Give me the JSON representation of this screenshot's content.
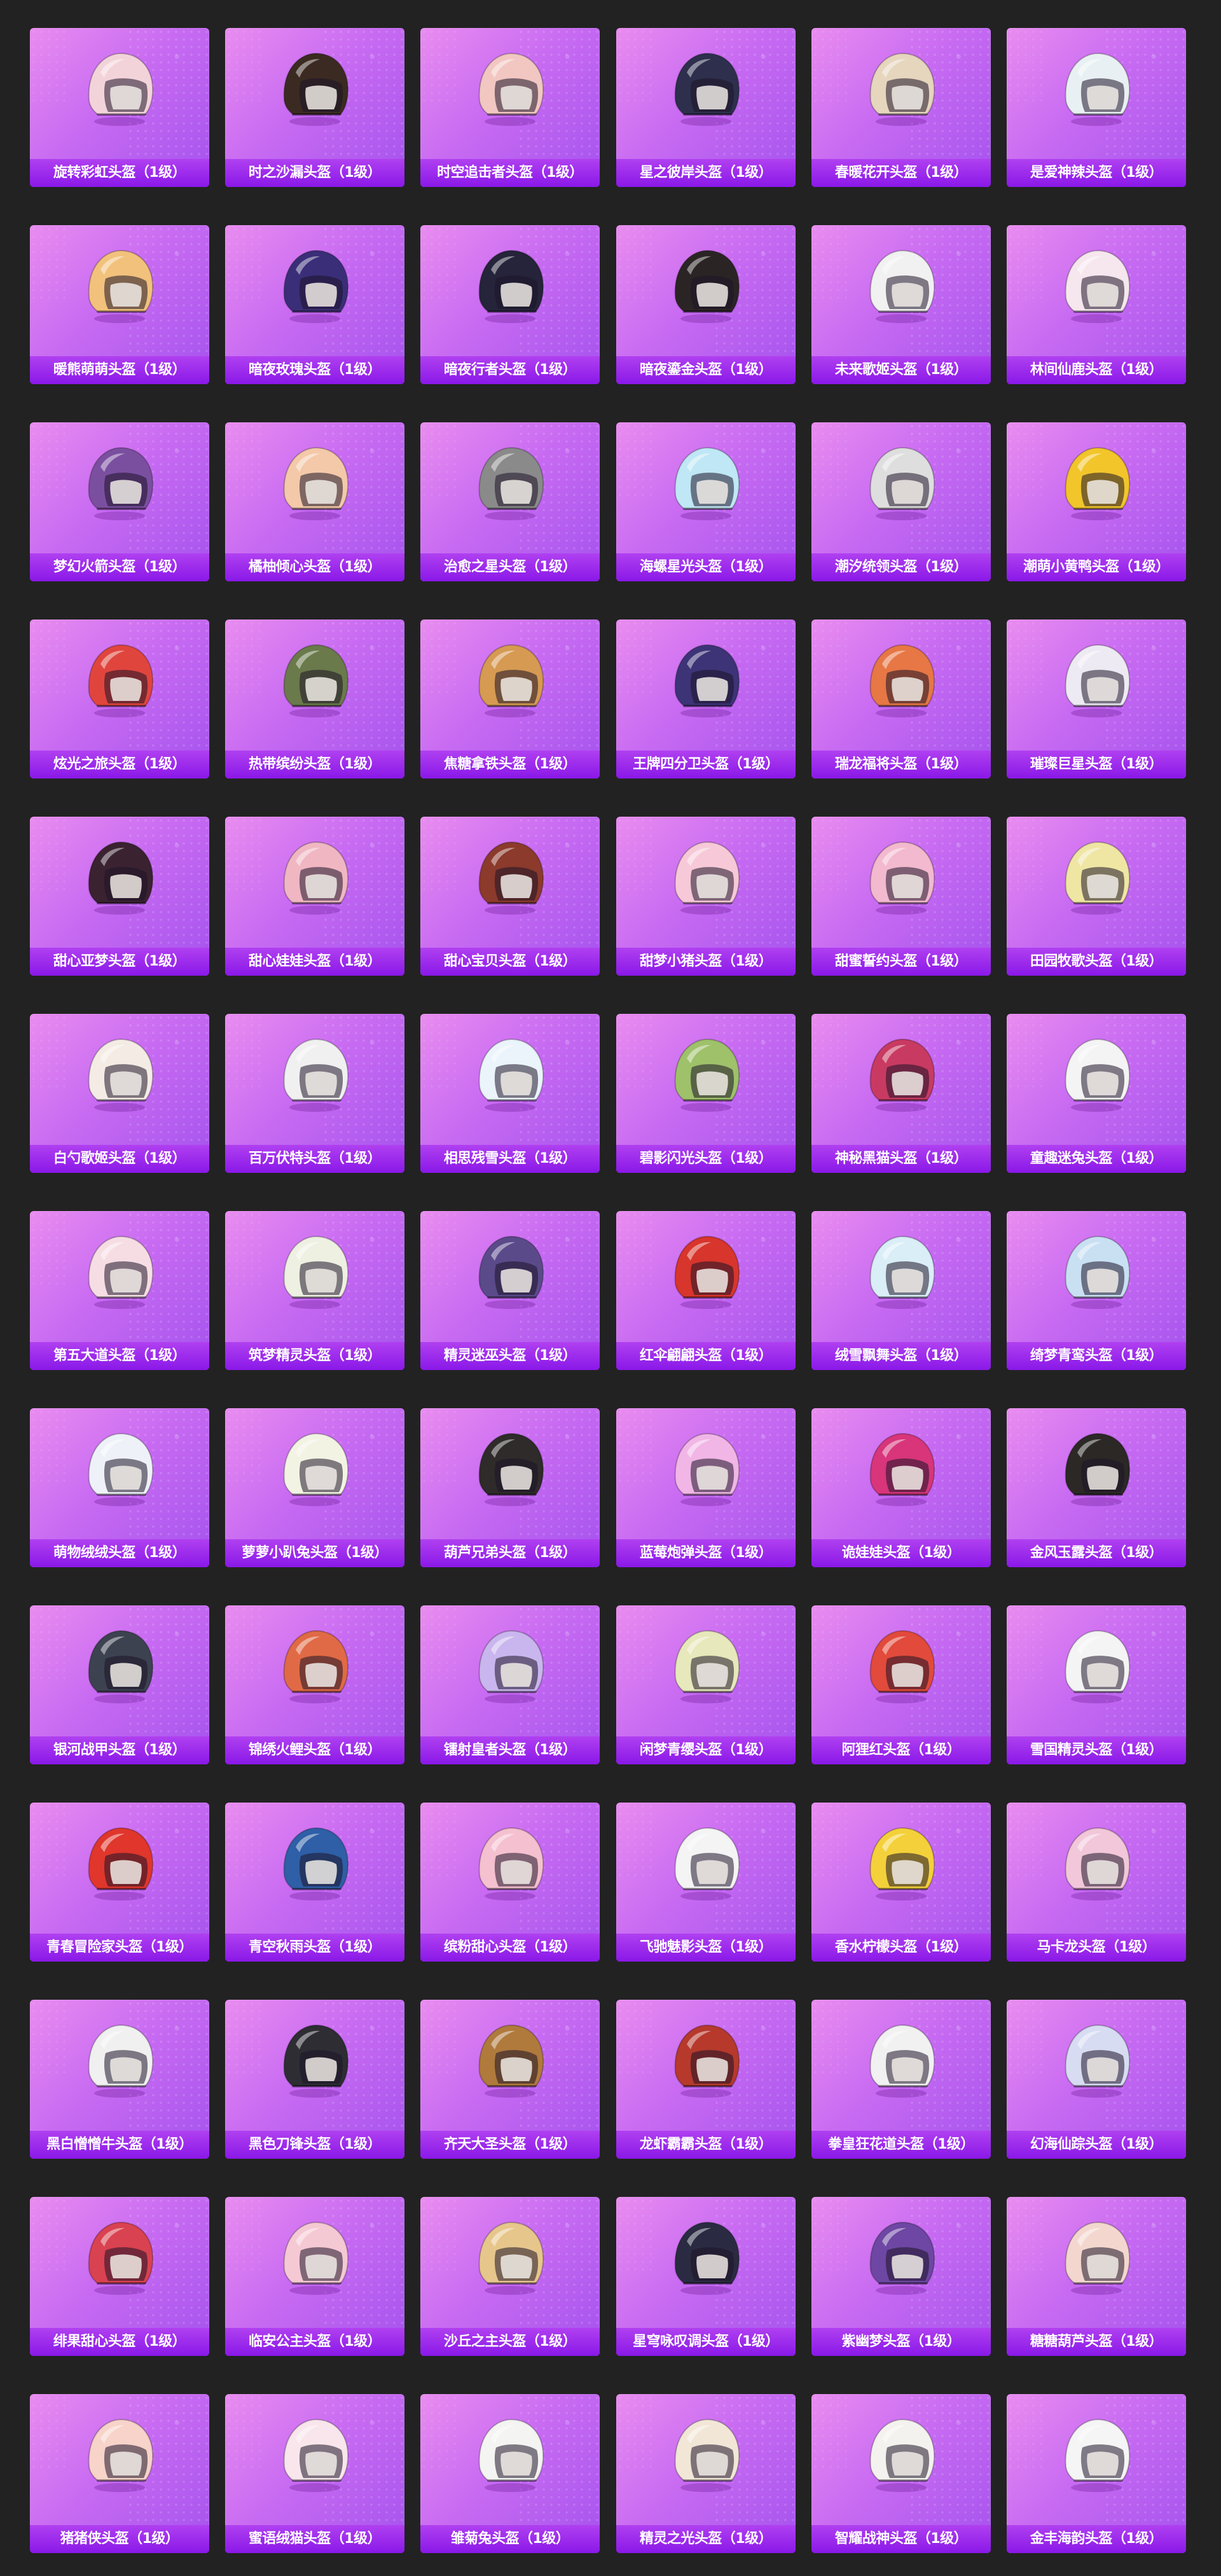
{
  "items": [
    {
      "name": "旋转彩虹头盔（1级）",
      "color": "#f3d3da"
    },
    {
      "name": "时之沙漏头盔（1级）",
      "color": "#3b2a22"
    },
    {
      "name": "时空追击者头盔（1级）",
      "color": "#f2c7c2"
    },
    {
      "name": "星之彼岸头盔（1级）",
      "color": "#2d2f4d"
    },
    {
      "name": "春暖花开头盔（1级）",
      "color": "#e6d6bd"
    },
    {
      "name": "是爱神辣头盔（1级）",
      "color": "#e9f0f3"
    },
    {
      "name": "暖熊萌萌头盔（1级）",
      "color": "#f2c27c"
    },
    {
      "name": "暗夜玫瑰头盔（1级）",
      "color": "#3a2e78"
    },
    {
      "name": "暗夜行者头盔（1级）",
      "color": "#25243a"
    },
    {
      "name": "暗夜鎏金头盔（1级）",
      "color": "#2b2424"
    },
    {
      "name": "未来歌姬头盔（1级）",
      "color": "#f1f1f1"
    },
    {
      "name": "林间仙鹿头盔（1级）",
      "color": "#f6e7ee"
    },
    {
      "name": "梦幻火箭头盔（1级）",
      "color": "#7b4fa0"
    },
    {
      "name": "橘柚倾心头盔（1级）",
      "color": "#f4c9a9"
    },
    {
      "name": "治愈之星头盔（1级）",
      "color": "#8a8a8a"
    },
    {
      "name": "海螺星光头盔（1级）",
      "color": "#bfe7f5"
    },
    {
      "name": "潮汐统领头盔（1级）",
      "color": "#dedede"
    },
    {
      "name": "潮萌小黄鸭头盔（1级）",
      "color": "#f2c52b"
    },
    {
      "name": "炫光之旅头盔（1级）",
      "color": "#e0453d"
    },
    {
      "name": "热带缤纷头盔（1级）",
      "color": "#6a7a4b"
    },
    {
      "name": "焦糖拿铁头盔（1级）",
      "color": "#d69a52"
    },
    {
      "name": "王牌四分卫头盔（1级）",
      "color": "#3d3377"
    },
    {
      "name": "瑞龙福将头盔（1级）",
      "color": "#e77745"
    },
    {
      "name": "璀璨巨星头盔（1级）",
      "color": "#eeeaf4"
    },
    {
      "name": "甜心亚梦头盔（1级）",
      "color": "#3a2230"
    },
    {
      "name": "甜心娃娃头盔（1级）",
      "color": "#f0b7c3"
    },
    {
      "name": "甜心宝贝头盔（1级）",
      "color": "#8b3a2c"
    },
    {
      "name": "甜梦小猪头盔（1级）",
      "color": "#f7c9d8"
    },
    {
      "name": "甜蜜誓约头盔（1级）",
      "color": "#f3b9ce"
    },
    {
      "name": "田园牧歌头盔（1级）",
      "color": "#efe6a4"
    },
    {
      "name": "白勺歌姬头盔（1级）",
      "color": "#f4ece4"
    },
    {
      "name": "百万伏特头盔（1级）",
      "color": "#f0f0f0"
    },
    {
      "name": "相思残雪头盔（1级）",
      "color": "#eaf4fa"
    },
    {
      "name": "碧影闪光头盔（1级）",
      "color": "#9ec16a"
    },
    {
      "name": "神秘黑猫头盔（1级）",
      "color": "#c83a62"
    },
    {
      "name": "童趣迷兔头盔（1级）",
      "color": "#f4f4f4"
    },
    {
      "name": "第五大道头盔（1级）",
      "color": "#f6dde4"
    },
    {
      "name": "筑梦精灵头盔（1级）",
      "color": "#eef0e2"
    },
    {
      "name": "精灵迷巫头盔（1级）",
      "color": "#5b4a8a"
    },
    {
      "name": "红伞翩翩头盔（1级）",
      "color": "#d8352c"
    },
    {
      "name": "绒雪飘舞头盔（1级）",
      "color": "#d9eef7"
    },
    {
      "name": "绮梦青鸾头盔（1级）",
      "color": "#c9e0f3"
    },
    {
      "name": "萌物绒绒头盔（1级）",
      "color": "#eef2f8"
    },
    {
      "name": "萝萝小趴兔头盔（1级）",
      "color": "#f3f3e4"
    },
    {
      "name": "葫芦兄弟头盔（1级）",
      "color": "#2e2b2a"
    },
    {
      "name": "蓝莓炮弹头盔（1级）",
      "color": "#f1b6e6"
    },
    {
      "name": "诡娃娃头盔（1级）",
      "color": "#d8357a"
    },
    {
      "name": "金风玉露头盔（1级）",
      "color": "#2b2826"
    },
    {
      "name": "银河战甲头盔（1级）",
      "color": "#3c4250"
    },
    {
      "name": "锦绣火鲤头盔（1级）",
      "color": "#e06a45"
    },
    {
      "name": "镭射皇者头盔（1级）",
      "color": "#c9b6ee"
    },
    {
      "name": "闲梦青缨头盔（1级）",
      "color": "#e7e8bb"
    },
    {
      "name": "阿狸红头盔（1级）",
      "color": "#e24a3b"
    },
    {
      "name": "雪国精灵头盔（1级）",
      "color": "#f4f4f4"
    },
    {
      "name": "青春冒险家头盔（1级）",
      "color": "#e0362c"
    },
    {
      "name": "青空秋雨头盔（1级）",
      "color": "#2e5fa7"
    },
    {
      "name": "缤粉甜心头盔（1级）",
      "color": "#f5c0cf"
    },
    {
      "name": "飞驰魅影头盔（1级）",
      "color": "#f4f4f4"
    },
    {
      "name": "香水柠檬头盔（1级）",
      "color": "#f4d13a"
    },
    {
      "name": "马卡龙头盔（1级）",
      "color": "#f1c7d9"
    },
    {
      "name": "黑白憎憎牛头盔（1级）",
      "color": "#f0f0f0"
    },
    {
      "name": "黑色刀锋头盔（1级）",
      "color": "#2d2d33"
    },
    {
      "name": "齐天大圣头盔（1级）",
      "color": "#b07a3c"
    },
    {
      "name": "龙虾霸霸头盔（1级）",
      "color": "#b6392c"
    },
    {
      "name": "拳皇狂花道头盔（1级）",
      "color": "#f1f1f1"
    },
    {
      "name": "幻海仙踪头盔（1级）",
      "color": "#d7dcf3"
    },
    {
      "name": "绯果甜心头盔（1级）",
      "color": "#d94250"
    },
    {
      "name": "临安公主头盔（1级）",
      "color": "#f5c9d4"
    },
    {
      "name": "沙丘之主头盔（1级）",
      "color": "#e7c68c"
    },
    {
      "name": "星穹咏叹调头盔（1级）",
      "color": "#2a2b42"
    },
    {
      "name": "紫幽梦头盔（1级）",
      "color": "#6d47a3"
    },
    {
      "name": "糖糖葫芦头盔（1级）",
      "color": "#f3d7cf"
    },
    {
      "name": "猪猪侠头盔（1级）",
      "color": "#f7d3c9"
    },
    {
      "name": "蜜语绒猫头盔（1级）",
      "color": "#f8e6ec"
    },
    {
      "name": "雏菊兔头盔（1级）",
      "color": "#f4f4f2"
    },
    {
      "name": "精灵之光头盔（1级）",
      "color": "#f2e7d7"
    },
    {
      "name": "智耀战神头盔（1级）",
      "color": "#f4f2ee"
    },
    {
      "name": "金丰海韵头盔（1级）",
      "color": "#f5f5f5"
    }
  ]
}
